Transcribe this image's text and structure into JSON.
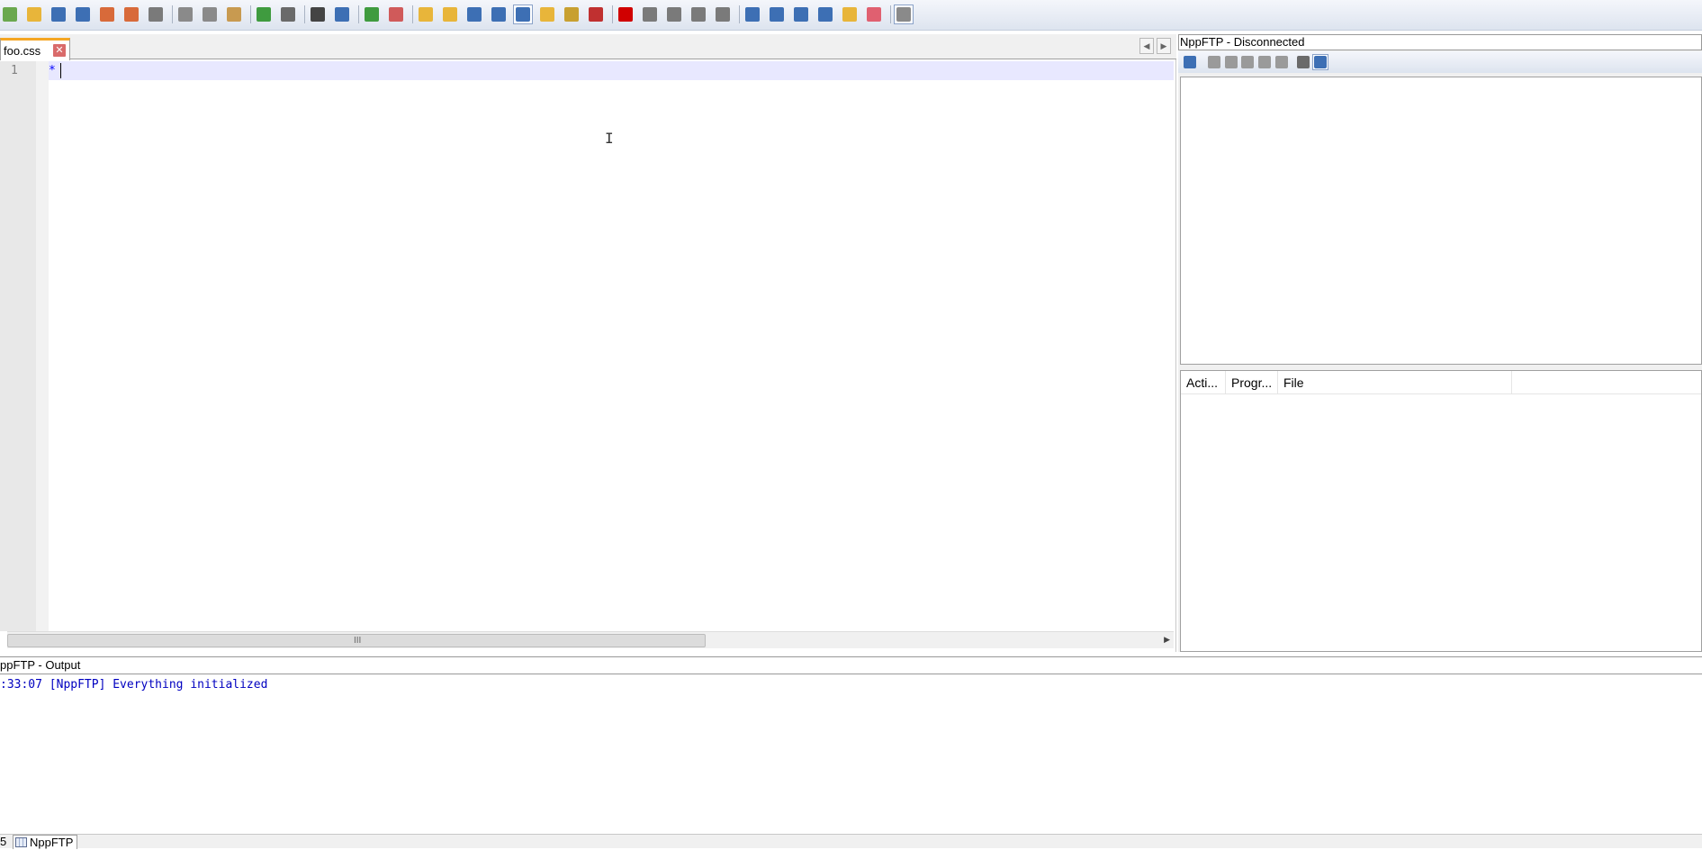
{
  "toolbar": {
    "buttons": [
      {
        "name": "new-file-icon",
        "color": "#6aa84f"
      },
      {
        "name": "open-file-icon",
        "color": "#e8b53a"
      },
      {
        "name": "save-icon",
        "color": "#3d6fb4"
      },
      {
        "name": "save-all-icon",
        "color": "#3d6fb4"
      },
      {
        "name": "close-file-icon",
        "color": "#d86a3a"
      },
      {
        "name": "close-all-icon",
        "color": "#d86a3a"
      },
      {
        "name": "print-icon",
        "color": "#7a7a7a"
      },
      {
        "name": "cut-icon",
        "color": "#8a8a8a"
      },
      {
        "name": "copy-icon",
        "color": "#8a8a8a"
      },
      {
        "name": "paste-icon",
        "color": "#c89a50"
      },
      {
        "name": "undo-icon",
        "color": "#3f9b3f"
      },
      {
        "name": "redo-icon",
        "color": "#6a6a6a"
      },
      {
        "name": "find-icon",
        "color": "#444444"
      },
      {
        "name": "replace-icon",
        "color": "#3d6fb4"
      },
      {
        "name": "zoom-in-icon",
        "color": "#3f9b3f"
      },
      {
        "name": "zoom-out-icon",
        "color": "#d05a5a"
      },
      {
        "name": "sync-vertical-icon",
        "color": "#e8b53a"
      },
      {
        "name": "sync-horizontal-icon",
        "color": "#e8b53a"
      },
      {
        "name": "word-wrap-icon",
        "color": "#3d6fb4"
      },
      {
        "name": "show-all-chars-icon",
        "color": "#3d6fb4"
      },
      {
        "name": "indent-guide-icon",
        "color": "#3d6fb4"
      },
      {
        "name": "user-lang-icon",
        "color": "#e8b53a"
      },
      {
        "name": "doc-map-icon",
        "color": "#c8a030"
      },
      {
        "name": "function-list-icon",
        "color": "#c03030"
      },
      {
        "name": "record-macro-icon",
        "color": "#d00000"
      },
      {
        "name": "stop-record-icon",
        "color": "#7a7a7a"
      },
      {
        "name": "play-macro-icon",
        "color": "#7a7a7a"
      },
      {
        "name": "run-macro-multiple-icon",
        "color": "#7a7a7a"
      },
      {
        "name": "save-macro-icon",
        "color": "#7a7a7a"
      },
      {
        "name": "sum-icon",
        "color": "#3d6fb4"
      },
      {
        "name": "up-arrow-icon",
        "color": "#3d6fb4"
      },
      {
        "name": "down-arrow-icon",
        "color": "#3d6fb4"
      },
      {
        "name": "sum-alt-icon",
        "color": "#3d6fb4"
      },
      {
        "name": "comment-icon",
        "color": "#e8b53a"
      },
      {
        "name": "heart-icon",
        "color": "#e06070"
      },
      {
        "name": "nppftp-toggle-icon",
        "color": "#8a8a8a"
      }
    ]
  },
  "editor": {
    "tab_label": "foo.css",
    "close_glyph": "✕",
    "line_number": "1",
    "code_line": "*",
    "nav_left": "◀",
    "nav_right": "▶",
    "scroll_grip": "III",
    "scroll_arrow": "▶"
  },
  "ftp": {
    "title": "NppFTP - Disconnected",
    "toolbar": [
      {
        "name": "connect-icon",
        "color": "#3d6fb4"
      },
      {
        "name": "download-icon",
        "color": "#9a9a9a"
      },
      {
        "name": "upload-icon",
        "color": "#9a9a9a"
      },
      {
        "name": "upload-alt-icon",
        "color": "#9a9a9a"
      },
      {
        "name": "refresh-icon",
        "color": "#9a9a9a"
      },
      {
        "name": "abort-icon",
        "color": "#9a9a9a"
      },
      {
        "name": "settings-icon",
        "color": "#6a6a6a"
      },
      {
        "name": "messages-icon",
        "color": "#3d6fb4"
      }
    ],
    "queue_columns": [
      "Acti...",
      "Progr...",
      "File"
    ]
  },
  "output": {
    "title": "ppFTP - Output",
    "log": ":33:07  [NppFTP] Everything initialized"
  },
  "bottom_tabs": {
    "left_fragment": "5",
    "active": "NppFTP"
  }
}
